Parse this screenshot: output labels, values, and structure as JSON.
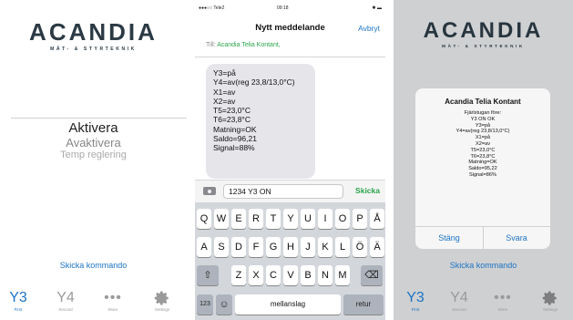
{
  "app": {
    "logo_main": "ACANDIA",
    "logo_sub": "MÄT- & STYRTEKNIK",
    "activate": "Aktivera",
    "deactivate": "Avaktivera",
    "temp_regulation": "Temp reglering",
    "temp_small": "",
    "send_command": "Skicka kommando",
    "tabs": [
      {
        "big": "Y3",
        "label": "First"
      },
      {
        "big": "Y4",
        "label": "Second"
      },
      {
        "big": "•••",
        "label": "More"
      },
      {
        "big": "",
        "label": "Settings"
      }
    ]
  },
  "messages": {
    "status_carrier": "●●●○○ Tele2",
    "status_time": "09:18",
    "status_right": "✱ ▬",
    "title": "Nytt meddelande",
    "cancel": "Avbryt",
    "to_label": "Till:",
    "to_value": "Acandia Telia Kontant,",
    "bubble_lines": [
      "Y3=på",
      "Y4=av(reg 23,8/13,0°C)",
      "X1=av",
      "X2=av",
      "T5=23,0°C",
      "T6=23,8°C",
      "Matning=OK",
      "Saldo=96,21",
      "Signal=88%"
    ],
    "input_value": "1234 Y3 ON",
    "send": "Skicka"
  },
  "keyboard": {
    "row1": [
      "Q",
      "W",
      "E",
      "R",
      "T",
      "Y",
      "U",
      "I",
      "O",
      "P",
      "Å"
    ],
    "row2": [
      "A",
      "S",
      "D",
      "F",
      "G",
      "H",
      "J",
      "K",
      "L",
      "Ö",
      "Ä"
    ],
    "row3": [
      "Z",
      "X",
      "C",
      "V",
      "B",
      "N",
      "M"
    ],
    "num": "123",
    "emoji": "☺",
    "space": "mellanslag",
    "return": "retur",
    "shift": "⇧",
    "delete": "⌫"
  },
  "dialog": {
    "title": "Acandia Telia Kontant",
    "lines": [
      "Fjärlstugan före:",
      "Y3 ON OK",
      "Y3=på",
      "Y4=av(reg 23,8/13,0°C)",
      "X1=på",
      "X2=av",
      "T5=23,0°C",
      "T6=23,8°C",
      "Matning=OK",
      "Saldo=95,22",
      "Signal=86%"
    ],
    "close": "Stäng",
    "reply": "Svara"
  },
  "colors": {
    "accent": "#1d74c4",
    "green": "#2aa54a"
  }
}
